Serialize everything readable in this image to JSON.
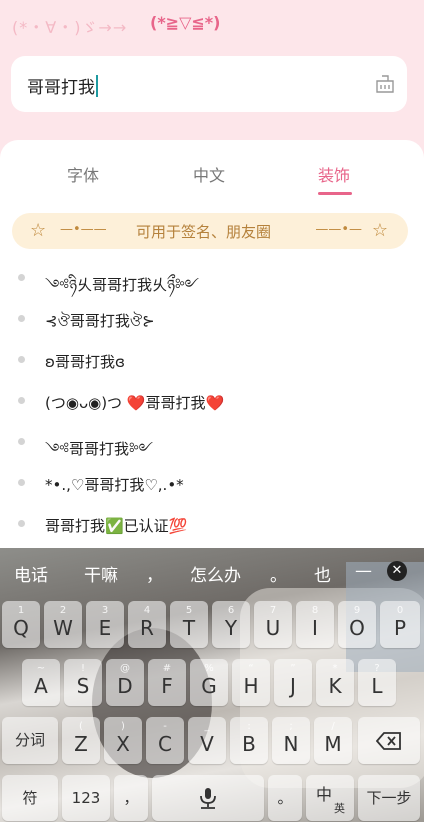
{
  "banner": {
    "kaomoji_left": "(*・∀・)ゞ→→",
    "kaomoji_right": "(*≧▽≦*)"
  },
  "search": {
    "value": "哥哥打我",
    "clear_icon": "basket-clear-icon"
  },
  "tabs": [
    {
      "label": "字体",
      "active": false
    },
    {
      "label": "中文",
      "active": false
    },
    {
      "label": "装饰",
      "active": true
    }
  ],
  "hint": {
    "star": "☆",
    "line_left": "—•——",
    "line_right": "——•—",
    "text": "可用于签名、朋友圈"
  },
  "items": [
    "༺ཉི乆哥哥打我乆ཉྀ༻",
    "⊰ঔ哥哥打我ঔ⊱",
    "ʚ哥哥打我ɞ",
    "(つ◉ᴗ◉)つ ❤️哥哥打我❤️",
    "༺哥哥打我༻",
    "*•.,♡哥哥打我♡,.•*",
    "哥哥打我✅已认证💯"
  ],
  "keyboard": {
    "suggestions": [
      "电话",
      "干嘛",
      "，",
      "怎么办",
      "。",
      "也",
      "—"
    ],
    "row1": [
      {
        "main": "Q",
        "sub": "1"
      },
      {
        "main": "W",
        "sub": "2"
      },
      {
        "main": "E",
        "sub": "3"
      },
      {
        "main": "R",
        "sub": "4"
      },
      {
        "main": "T",
        "sub": "5"
      },
      {
        "main": "Y",
        "sub": "6"
      },
      {
        "main": "U",
        "sub": "7"
      },
      {
        "main": "I",
        "sub": "8"
      },
      {
        "main": "O",
        "sub": "9"
      },
      {
        "main": "P",
        "sub": "0"
      }
    ],
    "row2": [
      {
        "main": "A",
        "sub": "~"
      },
      {
        "main": "S",
        "sub": "!"
      },
      {
        "main": "D",
        "sub": "@"
      },
      {
        "main": "F",
        "sub": "#"
      },
      {
        "main": "G",
        "sub": "%"
      },
      {
        "main": "H",
        "sub": "“"
      },
      {
        "main": "J",
        "sub": "”"
      },
      {
        "main": "K",
        "sub": "*"
      },
      {
        "main": "L",
        "sub": "?"
      }
    ],
    "row3": [
      {
        "main": "Z",
        "sub": "("
      },
      {
        "main": "X",
        "sub": ")"
      },
      {
        "main": "C",
        "sub": "-"
      },
      {
        "main": "V",
        "sub": "_"
      },
      {
        "main": "B",
        "sub": ":"
      },
      {
        "main": "N",
        "sub": ";"
      },
      {
        "main": "M",
        "sub": "/"
      }
    ],
    "fn": {
      "segment": "分词",
      "symbol": "符",
      "numbers": "123",
      "comma": "，",
      "period": "。",
      "lang_main": "中",
      "lang_sub": "英",
      "next": "下一步"
    }
  },
  "colors": {
    "accent": "#e8658a",
    "background": "#fde6ea",
    "hint_bg": "#fdf0d9",
    "caret": "#1e9aa0"
  }
}
